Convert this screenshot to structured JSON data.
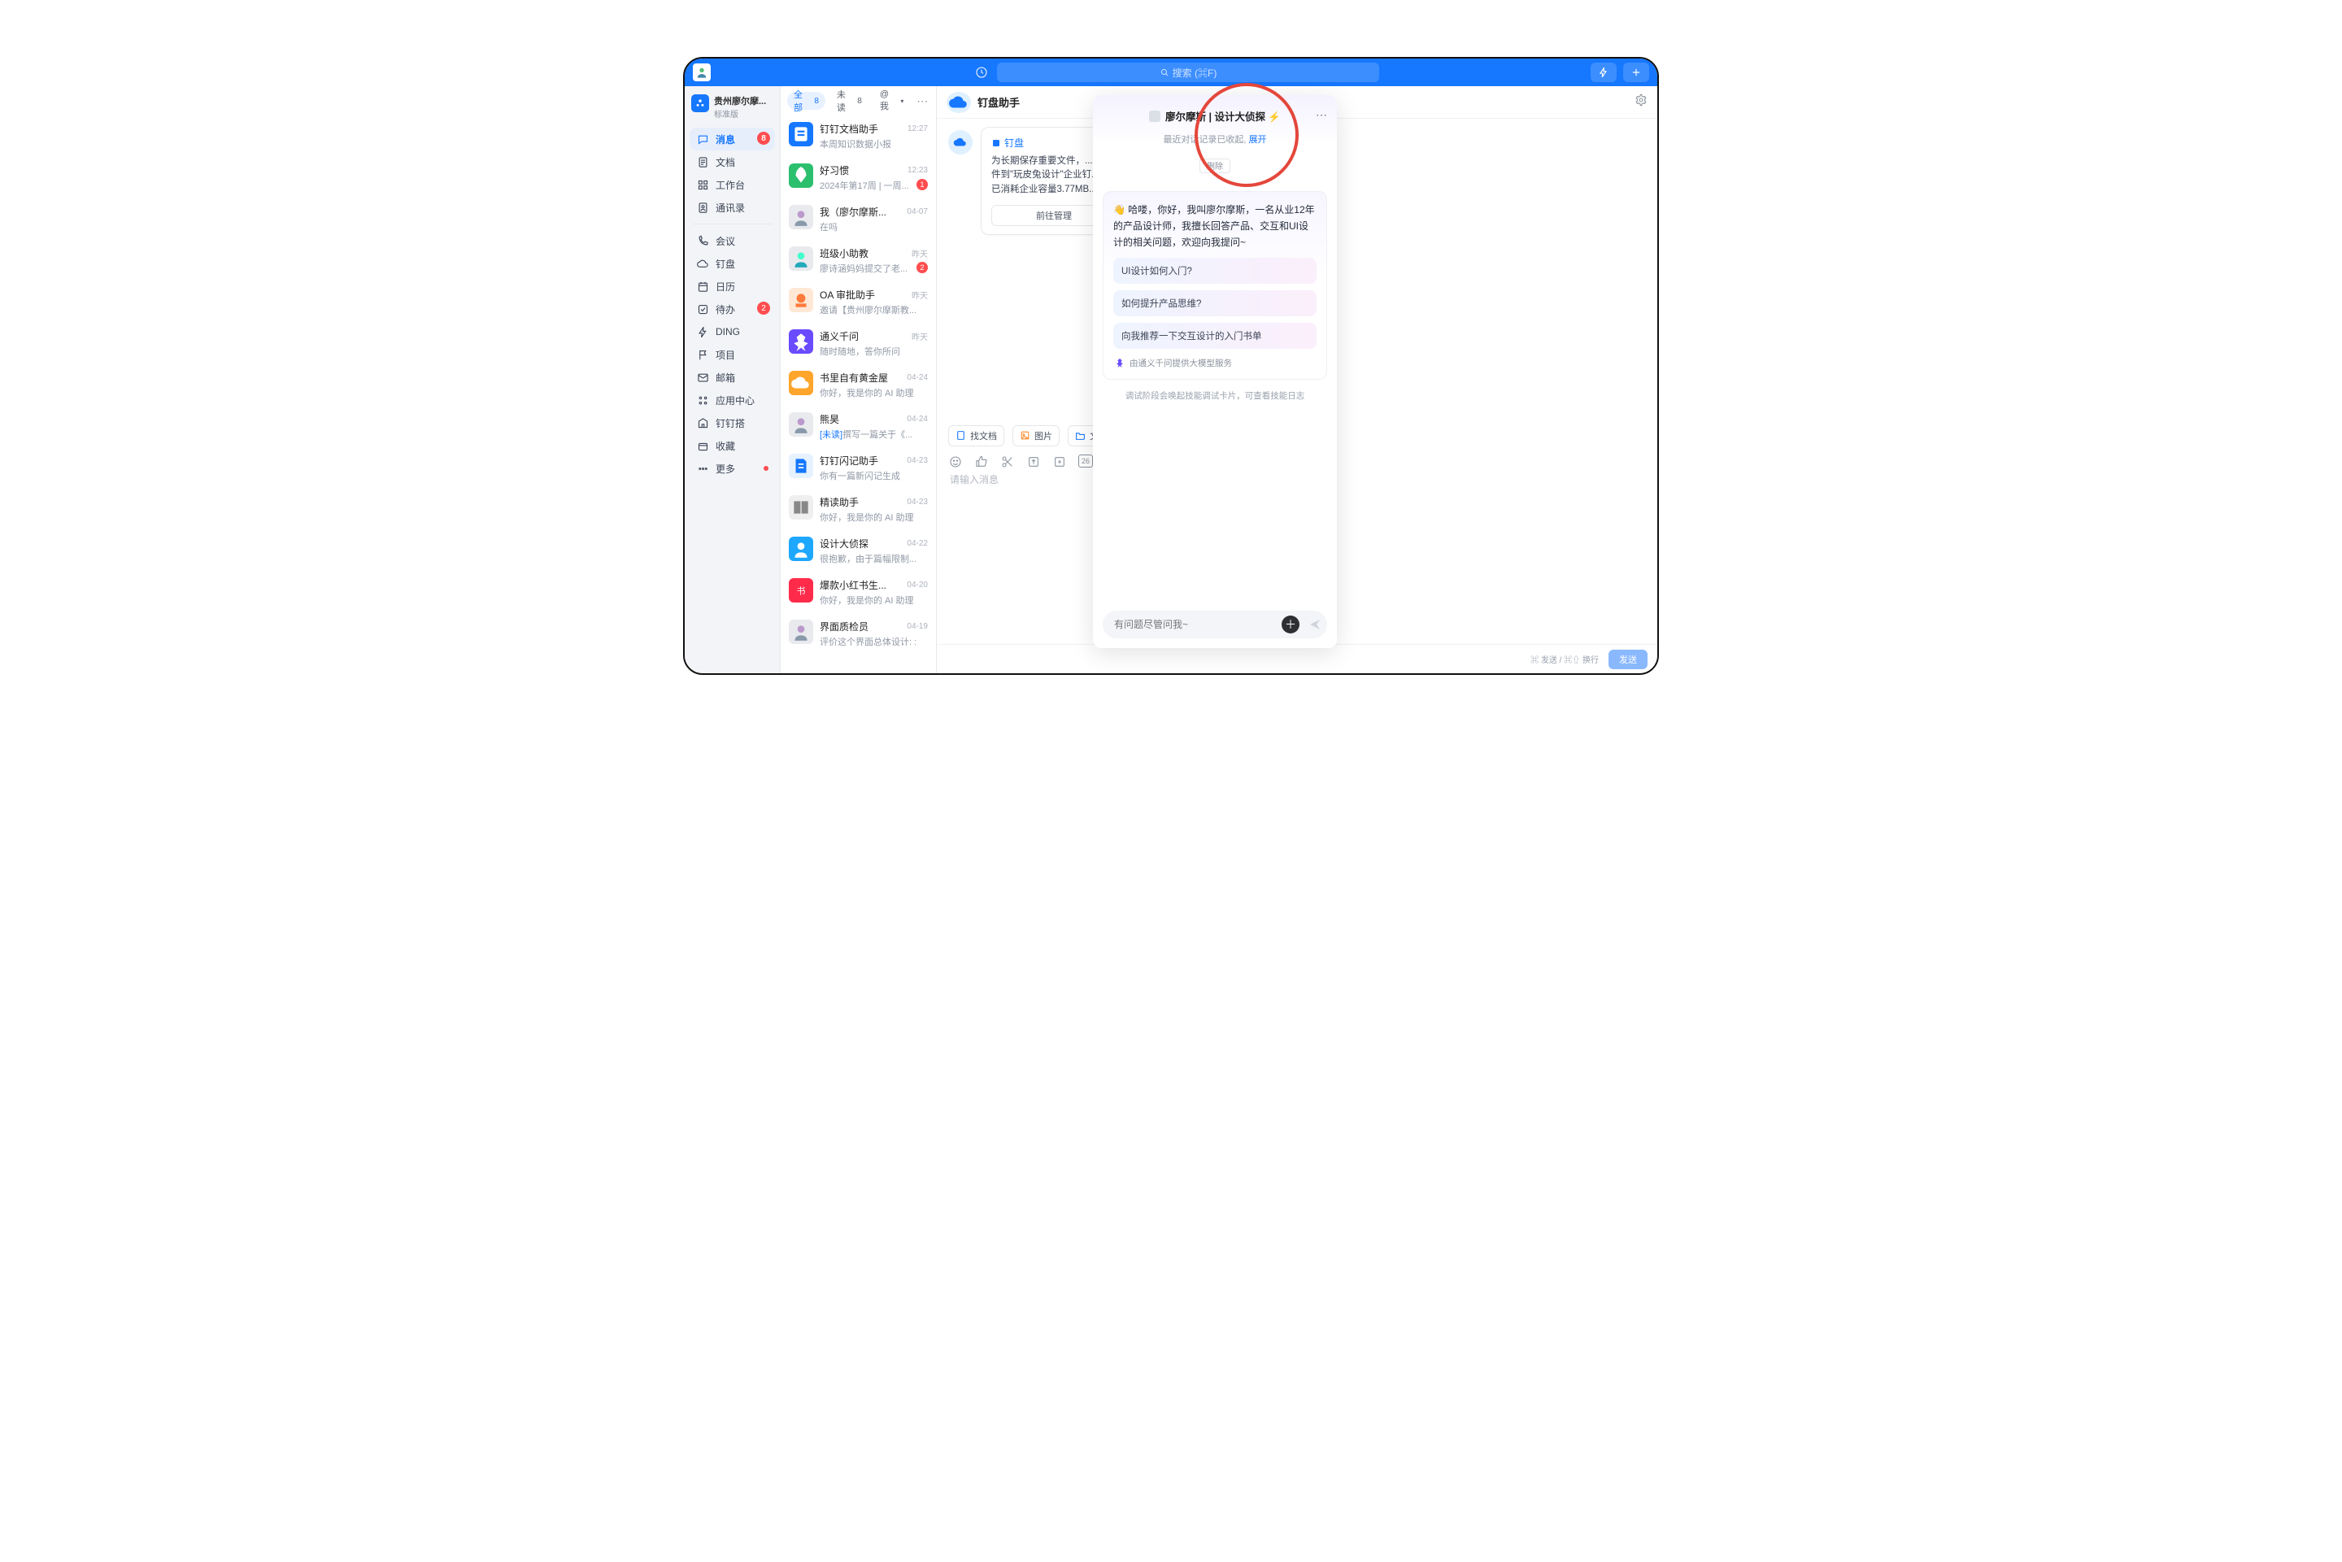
{
  "topbar": {
    "search_placeholder": "搜索 (⌘F)"
  },
  "workspace": {
    "title": "贵州廖尔摩...",
    "plan": "标准版"
  },
  "nav": [
    {
      "key": "messages",
      "label": "消息",
      "icon": "chat",
      "badge": "8",
      "active": true
    },
    {
      "key": "docs",
      "label": "文档",
      "icon": "doc"
    },
    {
      "key": "workbench",
      "label": "工作台",
      "icon": "grid"
    },
    {
      "key": "contacts",
      "label": "通讯录",
      "icon": "contacts"
    },
    {
      "sep": true
    },
    {
      "key": "meeting",
      "label": "会议",
      "icon": "phone"
    },
    {
      "key": "drive",
      "label": "钉盘",
      "icon": "cloud"
    },
    {
      "key": "calendar",
      "label": "日历",
      "icon": "cal"
    },
    {
      "key": "todo",
      "label": "待办",
      "icon": "check",
      "badge": "2"
    },
    {
      "key": "ding",
      "label": "DING",
      "icon": "bolt"
    },
    {
      "key": "project",
      "label": "项目",
      "icon": "flag"
    },
    {
      "key": "mail",
      "label": "邮箱",
      "icon": "mail"
    },
    {
      "key": "appcenter",
      "label": "应用中心",
      "icon": "apps"
    },
    {
      "key": "dingda",
      "label": "钉钉搭",
      "icon": "build"
    },
    {
      "key": "fav",
      "label": "收藏",
      "icon": "box"
    },
    {
      "key": "more",
      "label": "更多",
      "icon": "more",
      "dot": true
    }
  ],
  "tabs": {
    "all_label": "全部",
    "all_count": "8",
    "unread_label": "未读",
    "unread_count": "8",
    "at_label": "@我"
  },
  "conversations": [
    {
      "name": "钉钉文档助手",
      "sub": "本周知识数据小报",
      "time": "12:27",
      "color": "#1677ff",
      "icon": "doc"
    },
    {
      "name": "好习惯",
      "sub": "2024年第17周 | 一周...",
      "time": "12:23",
      "color": "#2bbf6e",
      "icon": "rocket",
      "badge": "1"
    },
    {
      "name": "我（廖尔摩斯...",
      "sub": "在吗",
      "time": "04-07",
      "color": "#e8eaee",
      "icon": "person"
    },
    {
      "name": "班级小助教",
      "sub": "廖诗涵妈妈提交了老...",
      "time": "昨天",
      "color": "#e8eaee",
      "icon": "teacher",
      "badge": "2"
    },
    {
      "name": "OA 审批助手",
      "sub": "邀请【贵州廖尔摩斯教...",
      "time": "昨天",
      "color": "#ffe8d6",
      "icon": "stamp"
    },
    {
      "name": "通义千问",
      "sub": "随时随地，答你所问",
      "time": "昨天",
      "color": "#6a4bff",
      "icon": "tongyi"
    },
    {
      "name": "书里自有黄金屋",
      "sub": "你好，我是你的 AI 助理",
      "time": "04-24",
      "color": "#ffa52b",
      "icon": "cloud2"
    },
    {
      "name": "熊昊",
      "sub_prefix": "[未读]",
      "sub": "撰写一篇关于《...",
      "time": "04-24",
      "color": "#e8eaee",
      "icon": "person"
    },
    {
      "name": "钉钉闪记助手",
      "sub": "你有一篇新闪记生成",
      "time": "04-23",
      "color": "#e6f2ff",
      "icon": "note"
    },
    {
      "name": "精读助手",
      "sub": "你好，我是你的 AI 助理",
      "time": "04-23",
      "color": "#efefef",
      "icon": "read"
    },
    {
      "name": "设计大侦探",
      "sub": "很抱歉，由于篇幅限制...",
      "time": "04-22",
      "color": "#1ea7ff",
      "icon": "person2"
    },
    {
      "name": "爆款小红书生...",
      "sub": "你好，我是你的 AI 助理",
      "time": "04-20",
      "color": "#ff2b4a",
      "icon": "xhs"
    },
    {
      "name": "界面质检员",
      "sub": "评价这个界面总体设计:  :",
      "time": "04-19",
      "color": "#e8eaee",
      "icon": "person"
    }
  ],
  "chat": {
    "title": "钉盘助手",
    "card_link": "钉盘",
    "card_desc": "为长期保存重要文件，...\n件到\"玩皮兔设计\"企业钉...\n已消耗企业容量3.77MB...",
    "card_btn": "前往管理",
    "chip_doc": "找文档",
    "chip_img": "图片",
    "chip_file": "文件",
    "toolbar_date": "26",
    "input_placeholder": "请输入消息",
    "hint": "⌘ 发送 / ⌘⇧ 换行",
    "send": "发送"
  },
  "agent": {
    "title": "廖尔摩斯 | 设计大侦探 ⚡",
    "collapse_note": "最近对话记录已收起,",
    "expand": "展开",
    "tag": "删除",
    "hello": "👋 哈喽，你好，我叫廖尔摩斯，一名从业12年的产品设计师，我擅长回答产品、交互和UI设计的相关问题，欢迎向我提问~",
    "suggestions": [
      "UI设计如何入门?",
      "如何提升产品思维?",
      "向我推荐一下交互设计的入门书单"
    ],
    "powered": "由通义千问提供大模型服务",
    "debug_note": "调试阶段会唤起技能调试卡片，可查看技能日志",
    "ask_placeholder": "有问题尽管问我~"
  }
}
